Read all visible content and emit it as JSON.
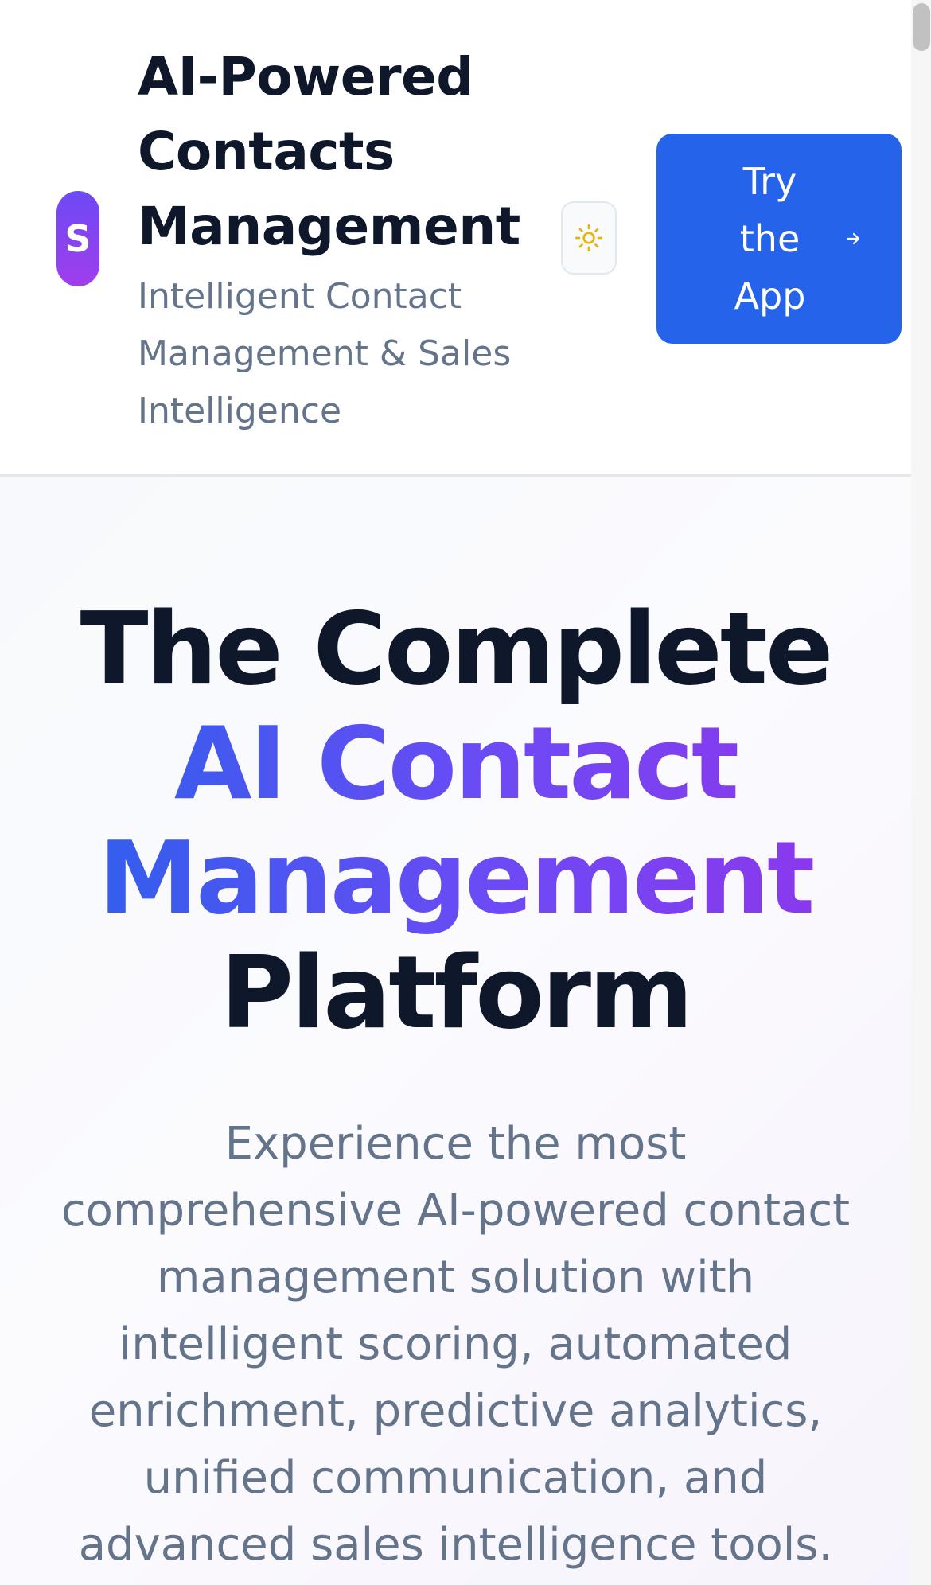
{
  "header": {
    "logo_letter": "S",
    "brand_title": "AI-Powered Contacts Management",
    "brand_subtitle": "Intelligent Contact Management & Sales Intelligence",
    "theme_toggle_icon": "sun-icon",
    "cta_label": "Try the App",
    "cta_icon": "arrow-right-icon"
  },
  "hero": {
    "heading_line1": "The Complete",
    "heading_line2": "AI Contact",
    "heading_line3": "Management",
    "heading_line4": "Platform",
    "description": "Experience the most comprehensive AI-powered contact management solution with intelligent scoring, automated enrichment, predictive analytics, unified communication, and advanced sales intelligence tools."
  },
  "colors": {
    "primary": "#2563eb",
    "accent_purple": "#9333ea",
    "heading": "#0f172a",
    "muted_text": "#64748b",
    "sun": "#eab308"
  }
}
